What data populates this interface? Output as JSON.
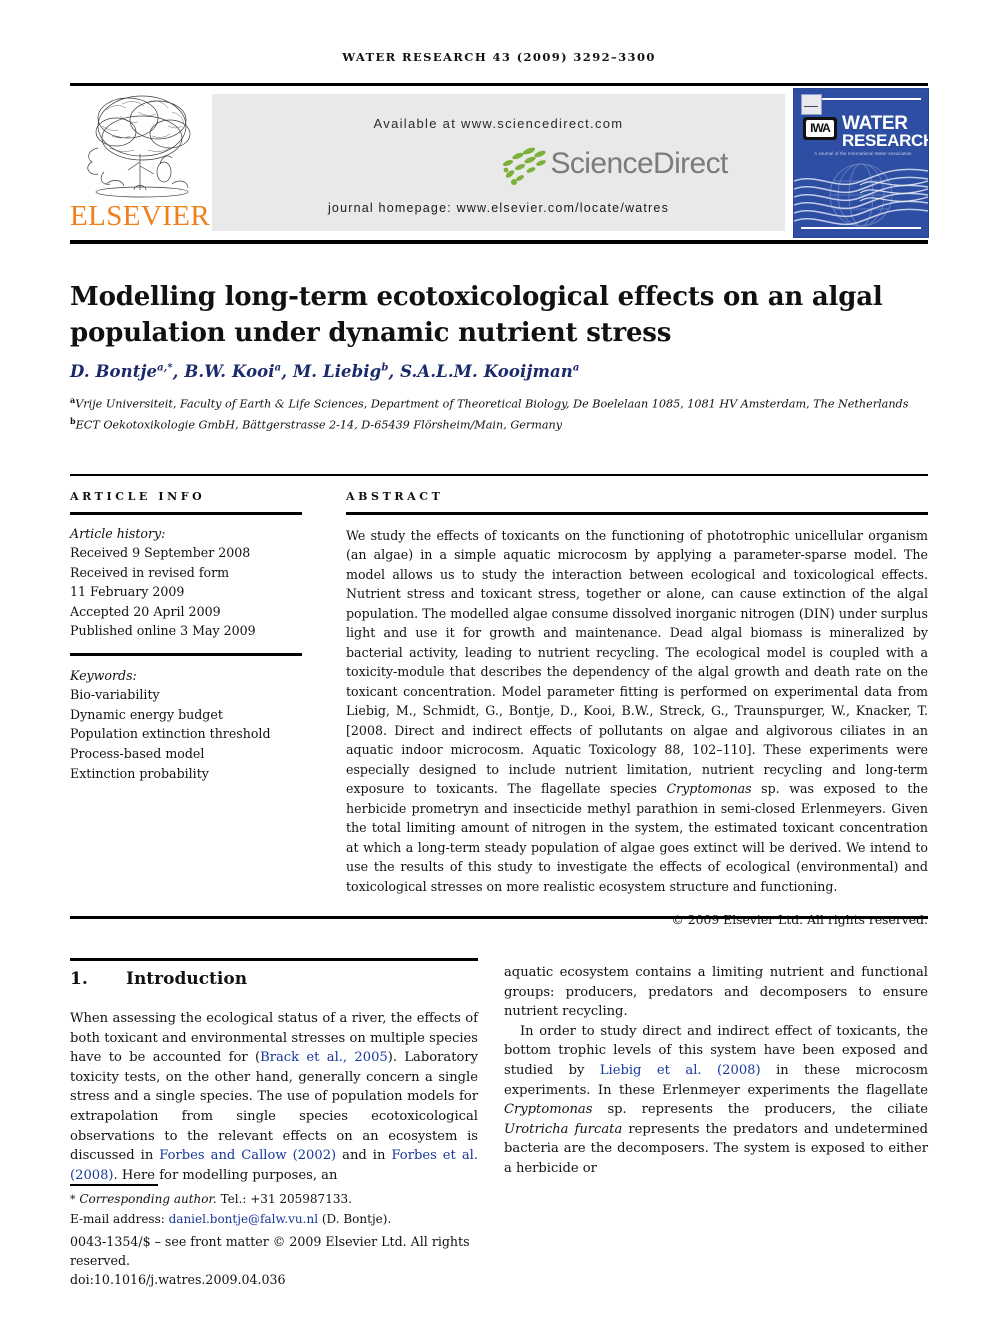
{
  "running_head": "WATER RESEARCH 43 (2009) 3292–3300",
  "masthead": {
    "elsevier_wordmark": "ELSEVIER",
    "available_at": "Available at www.sciencedirect.com",
    "sciencedirect_wordmark": "ScienceDirect",
    "journal_homepage": "journal homepage: www.elsevier.com/locate/watres",
    "cover": {
      "title_line1": "WATER",
      "title_line2": "RESEARCH",
      "subtitle": "A Journal of the International Water Association",
      "iwa_mark": "IWA"
    },
    "colors": {
      "elsevier_orange": "#F07F1A",
      "sciencedirect_green": "#7DAF3C",
      "sciencedirect_gray": "#7b7b7b",
      "cover_blue": "#2d4ea2",
      "link_blue": "#16379b"
    }
  },
  "article": {
    "title": "Modelling long-term ecotoxicological effects on an algal population under dynamic nutrient stress",
    "authors_html": "D. Bontje<sup>a,*</sup>, B.W. Kooi<sup>a</sup>, M. Liebig<sup>b</sup>, S.A.L.M. Kooijman<sup>a</sup>",
    "affiliations_html": "<sup>a</sup>Vrije Universiteit, Faculty of Earth &amp; Life Sciences, Department of Theoretical Biology, De Boelelaan 1085, 1081 HV Amsterdam, The Netherlands<br><sup>b</sup>ECT Oekotoxikologie GmbH, B&auml;ttgerstrasse 2-14, D-65439 Fl&ouml;rsheim/Main, Germany"
  },
  "article_info": {
    "heading": "ARTICLE INFO",
    "history_label": "Article history:",
    "history": [
      "Received 9 September 2008",
      "Received in revised form",
      "11 February 2009",
      "Accepted 20 April 2009",
      "Published online 3 May 2009"
    ],
    "keywords_label": "Keywords:",
    "keywords": [
      "Bio-variability",
      "Dynamic energy budget",
      "Population extinction threshold",
      "Process-based model",
      "Extinction probability"
    ]
  },
  "abstract": {
    "heading": "ABSTRACT",
    "text_html": "We study the effects of toxicants on the functioning of phototrophic unicellular organism (an algae) in a simple aquatic microcosm by applying a parameter-sparse model. The model allows us to study the interaction between ecological and toxicological effects. Nutrient stress and toxicant stress, together or alone, can cause extinction of the algal population. The modelled algae consume dissolved inorganic nitrogen (DIN) under surplus light and use it for growth and maintenance. Dead algal biomass is mineralized by bacterial activity, leading to nutrient recycling. The ecological model is coupled with a toxicity-module that describes the dependency of the algal growth and death rate on the toxicant concentration. Model parameter fitting is performed on experimental data from Liebig, M., Schmidt, G., Bontje, D., Kooi, B.W., Streck, G., Traunspurger, W., Knacker, T. [2008. Direct and indirect effects of pollutants on algae and algivorous ciliates in an aquatic indoor microcosm. Aquatic Toxicology 88, 102&ndash;110]. These experiments were especially designed to include nutrient limitation, nutrient recycling and long-term exposure to toxicants. The flagellate species <i>Cryptomonas</i> sp. was exposed to the herbicide prometryn and insecticide methyl parathion in semi-closed Erlenmeyers. Given the total limiting amount of nitrogen in the system, the estimated toxicant concentration at which a long-term steady population of algae goes extinct will be derived. We intend to use the results of this study to investigate the effects of ecological (environmental) and toxicological stresses on more realistic ecosystem structure and functioning.",
    "copyright": "© 2009 Elsevier Ltd. All rights reserved."
  },
  "body": {
    "section_number": "1.",
    "section_title": "Introduction",
    "left_column_html": "When assessing the ecological status of a river, the effects of both toxicant and environmental stresses on multiple species have to be accounted for (<a class=\"ref\" href=\"#\" data-name=\"citation-link\">Brack et al., 2005</a>). Laboratory toxicity tests, on the other hand, generally concern a single stress and a single species. The use of population models for extrapolation from single species ecotoxicological observations to the relevant effects on an ecosystem is discussed in <a class=\"ref\" href=\"#\" data-name=\"citation-link\">Forbes and Callow (2002)</a> and in <a class=\"ref\" href=\"#\" data-name=\"citation-link\">Forbes et al. (2008)</a>. Here for modelling purposes, an",
    "right_column_html": "<p>aquatic ecosystem contains a limiting nutrient and functional groups: producers, predators and decomposers to ensure nutrient recycling.</p><p>In order to study direct and indirect effect of toxicants, the bottom trophic levels of this system have been exposed and studied by <a class=\"ref\" href=\"#\" data-name=\"citation-link\">Liebig et al. (2008)</a> in these microcosm experiments. In these Erlenmeyer experiments the flagellate <i>Cryptomonas</i> sp. represents the producers, the ciliate <i>Urotricha furcata</i> represents the predators and undetermined bacteria are the decomposers. The system is exposed to either a herbicide or</p>"
  },
  "footer": {
    "corresponding_html": "<span class=\"star\">*</span> <span class=\"corr\">Corresponding author.</span> Tel.: +31 205987133.",
    "email_label": "E-mail address:",
    "email": "daniel.bontje@falw.vu.nl",
    "email_owner": "(D. Bontje).",
    "imprint_line1": "0043-1354/$ – see front matter © 2009 Elsevier Ltd. All rights reserved.",
    "imprint_line2": "doi:10.1016/j.watres.2009.04.036"
  }
}
